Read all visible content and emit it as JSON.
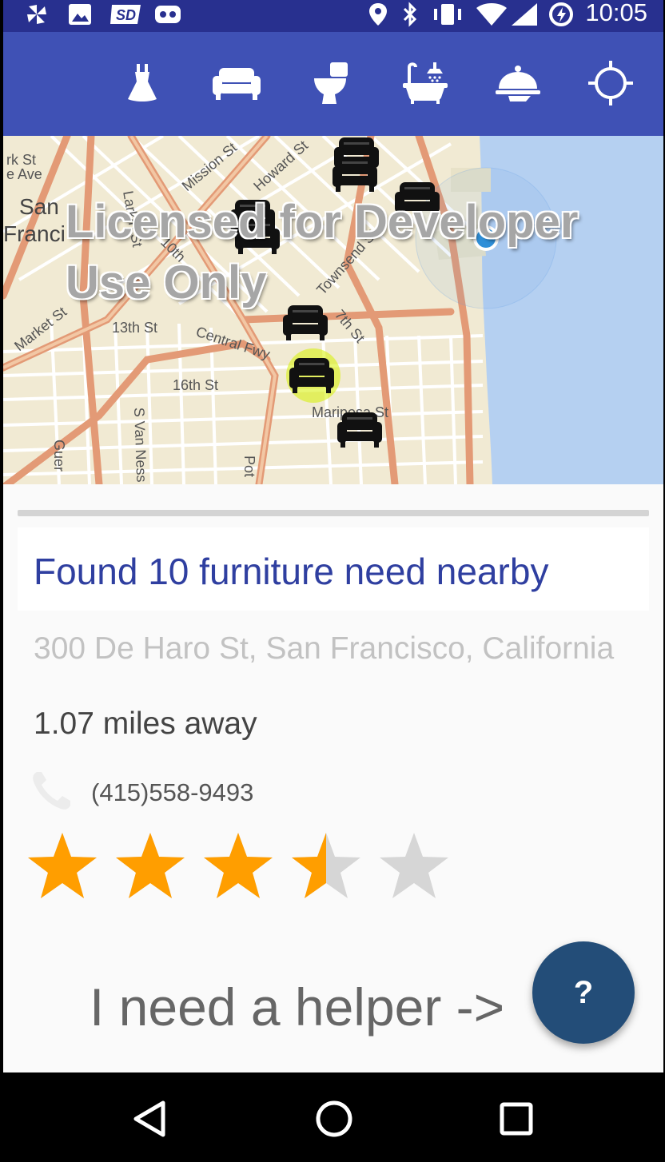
{
  "status_bar": {
    "time": "10:05",
    "left_icons": [
      "pinwheel-icon",
      "image-icon",
      "sd-card-icon",
      "robot-icon"
    ],
    "right_icons": [
      "location-icon",
      "bluetooth-icon",
      "vibrate-icon",
      "wifi-icon",
      "cell-signal-icon",
      "data-saver-icon"
    ]
  },
  "toolbar": {
    "categories": [
      {
        "name": "clothing",
        "icon": "dress-icon"
      },
      {
        "name": "furniture",
        "icon": "sofa-icon"
      },
      {
        "name": "toilet",
        "icon": "toilet-icon"
      },
      {
        "name": "bathtub",
        "icon": "bathtub-icon"
      },
      {
        "name": "food",
        "icon": "food-cloche-icon"
      },
      {
        "name": "locate",
        "icon": "crosshair-icon"
      }
    ]
  },
  "map": {
    "watermark_line1": "Licensed for Developer",
    "watermark_line2": "Use Only",
    "street_labels": {
      "market": "Market St",
      "mission": "Mission St",
      "howard": "Howard St",
      "thirteenth": "13th St",
      "central_fwy": "Central Fwy",
      "sixteenth": "16th St",
      "mariposa": "Mariposa St",
      "van_ness": "S Van Ness",
      "townsend": "Townsend St",
      "seventh": "7th St",
      "tenth": "10th",
      "larkin": "Larkin St",
      "san": "San",
      "franci": "Franci",
      "rk_st": "rk St",
      "e_ave": "e Ave",
      "guer": "Guer",
      "pot": "Pot"
    },
    "marker_icon": "sofa-marker-icon",
    "location_icon": "current-location-icon",
    "colors": {
      "land": "#f1ead3",
      "water": "#b5d0f1",
      "major_road": "#e39a76",
      "minor_road": "#ffffff",
      "highlight": "#d6f000"
    }
  },
  "result": {
    "title": "Found 10 furniture need nearby",
    "address": "300 De Haro St, San Francisco, California",
    "distance": "1.07 miles away",
    "phone": "(415)558-9493",
    "rating": 3.5,
    "rating_max": 5,
    "star_color": "#ff9e00",
    "star_empty_color": "#d6d6d6"
  },
  "action": {
    "helper_label": "I need a helper ->",
    "fab_label": "?"
  },
  "nav_bar": {
    "icons": [
      "back-icon",
      "home-icon",
      "recents-icon"
    ]
  }
}
